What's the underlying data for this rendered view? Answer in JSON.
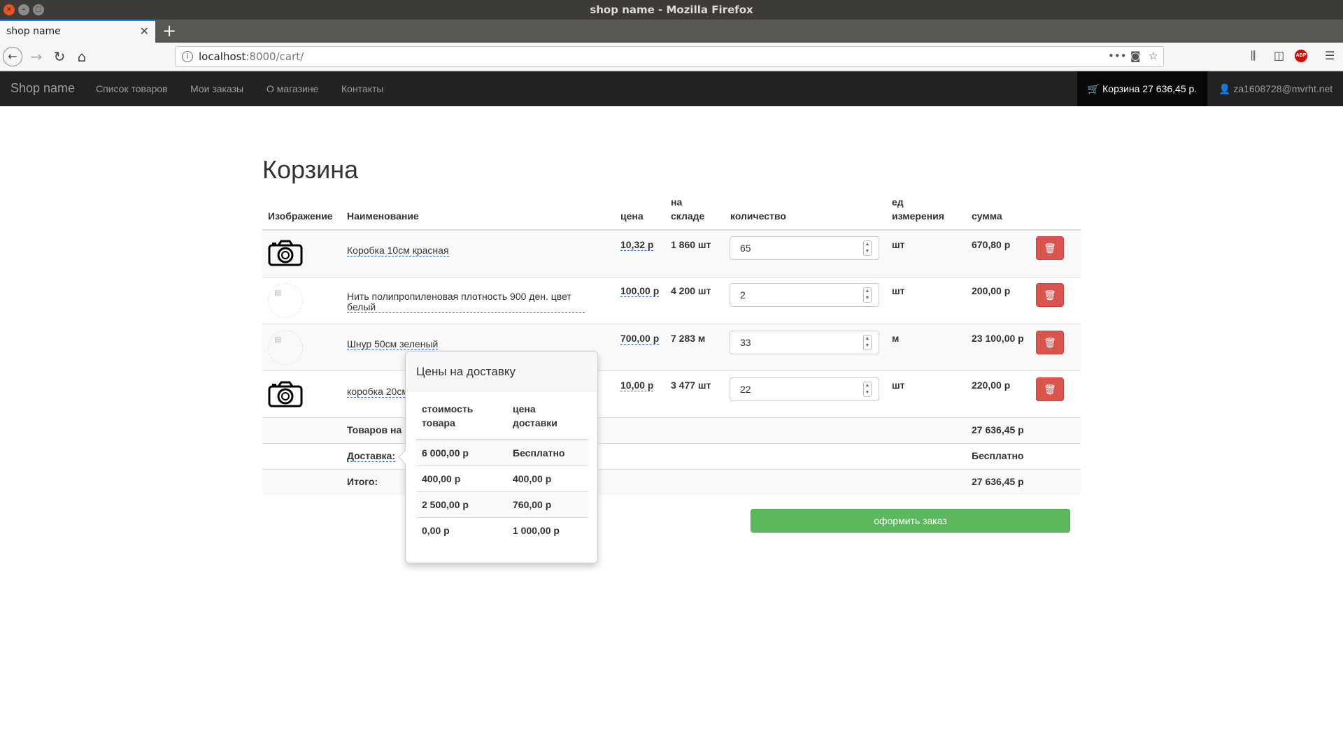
{
  "window": {
    "title": "shop name - Mozilla Firefox"
  },
  "browser": {
    "tab_title": "shop name",
    "url_host": "localhost",
    "url_rest": ":8000/cart/"
  },
  "site": {
    "brand": "Shop name",
    "nav": [
      "Список товаров",
      "Мои заказы",
      "О магазине",
      "Контакты"
    ],
    "cart": "Корзина 27 636,45 р.",
    "user": "za1608728@mvrht.net"
  },
  "cart": {
    "title": "Корзина",
    "headers": {
      "image": "Изображение",
      "name": "Наименование",
      "price": "цена",
      "stock_1": "на",
      "stock_2": "складе",
      "qty": "количество",
      "unit_1": "ед",
      "unit_2": "измерения",
      "sum": "сумма"
    },
    "rows": [
      {
        "image": "camera-icon",
        "name": "Коробка 10см красная",
        "price": "10,32 р",
        "stock": "1 860 шт",
        "qty": "65",
        "unit": "шт",
        "sum": "670,80 р"
      },
      {
        "image": "broken-image",
        "name": "Нить полипропиленовая плотность 900 ден. цвет белый",
        "price": "100,00 р",
        "stock": "4 200 шт",
        "qty": "2",
        "unit": "шт",
        "sum": "200,00 р"
      },
      {
        "image": "broken-image",
        "name": "Шнур 50см зеленый",
        "price": "700,00 р",
        "stock": "7 283 м",
        "qty": "33",
        "unit": "м",
        "sum": "23 100,00 р"
      },
      {
        "image": "camera-icon",
        "name": "коробка 20см",
        "price": "10,00 р",
        "stock": "3 477 шт",
        "qty": "22",
        "unit": "шт",
        "sum": "220,00 р"
      }
    ],
    "summary": {
      "goods_label": "Товаров на",
      "goods_value": "27 636,45 р",
      "delivery_label": "Доставка:",
      "delivery_value": "Бесплатно",
      "total_label": "Итого:",
      "total_value": "27 636,45 р"
    },
    "order_button": "оформить заказ"
  },
  "popover": {
    "title": "Цены на доставку",
    "headers": {
      "cost_1": "стоимость",
      "cost_2": "товара",
      "delivery_1": "цена",
      "delivery_2": "доставки"
    },
    "rows": [
      {
        "cost": "6 000,00 р",
        "delivery": "Бесплатно"
      },
      {
        "cost": "400,00 р",
        "delivery": "400,00 р"
      },
      {
        "cost": "2 500,00 р",
        "delivery": "760,00 р"
      },
      {
        "cost": "0,00 р",
        "delivery": "1 000,00 р"
      }
    ]
  },
  "colors": {
    "navbar": "#222222",
    "danger": "#d9534f",
    "success": "#5cb85c",
    "link_underline": "#3366cc"
  }
}
